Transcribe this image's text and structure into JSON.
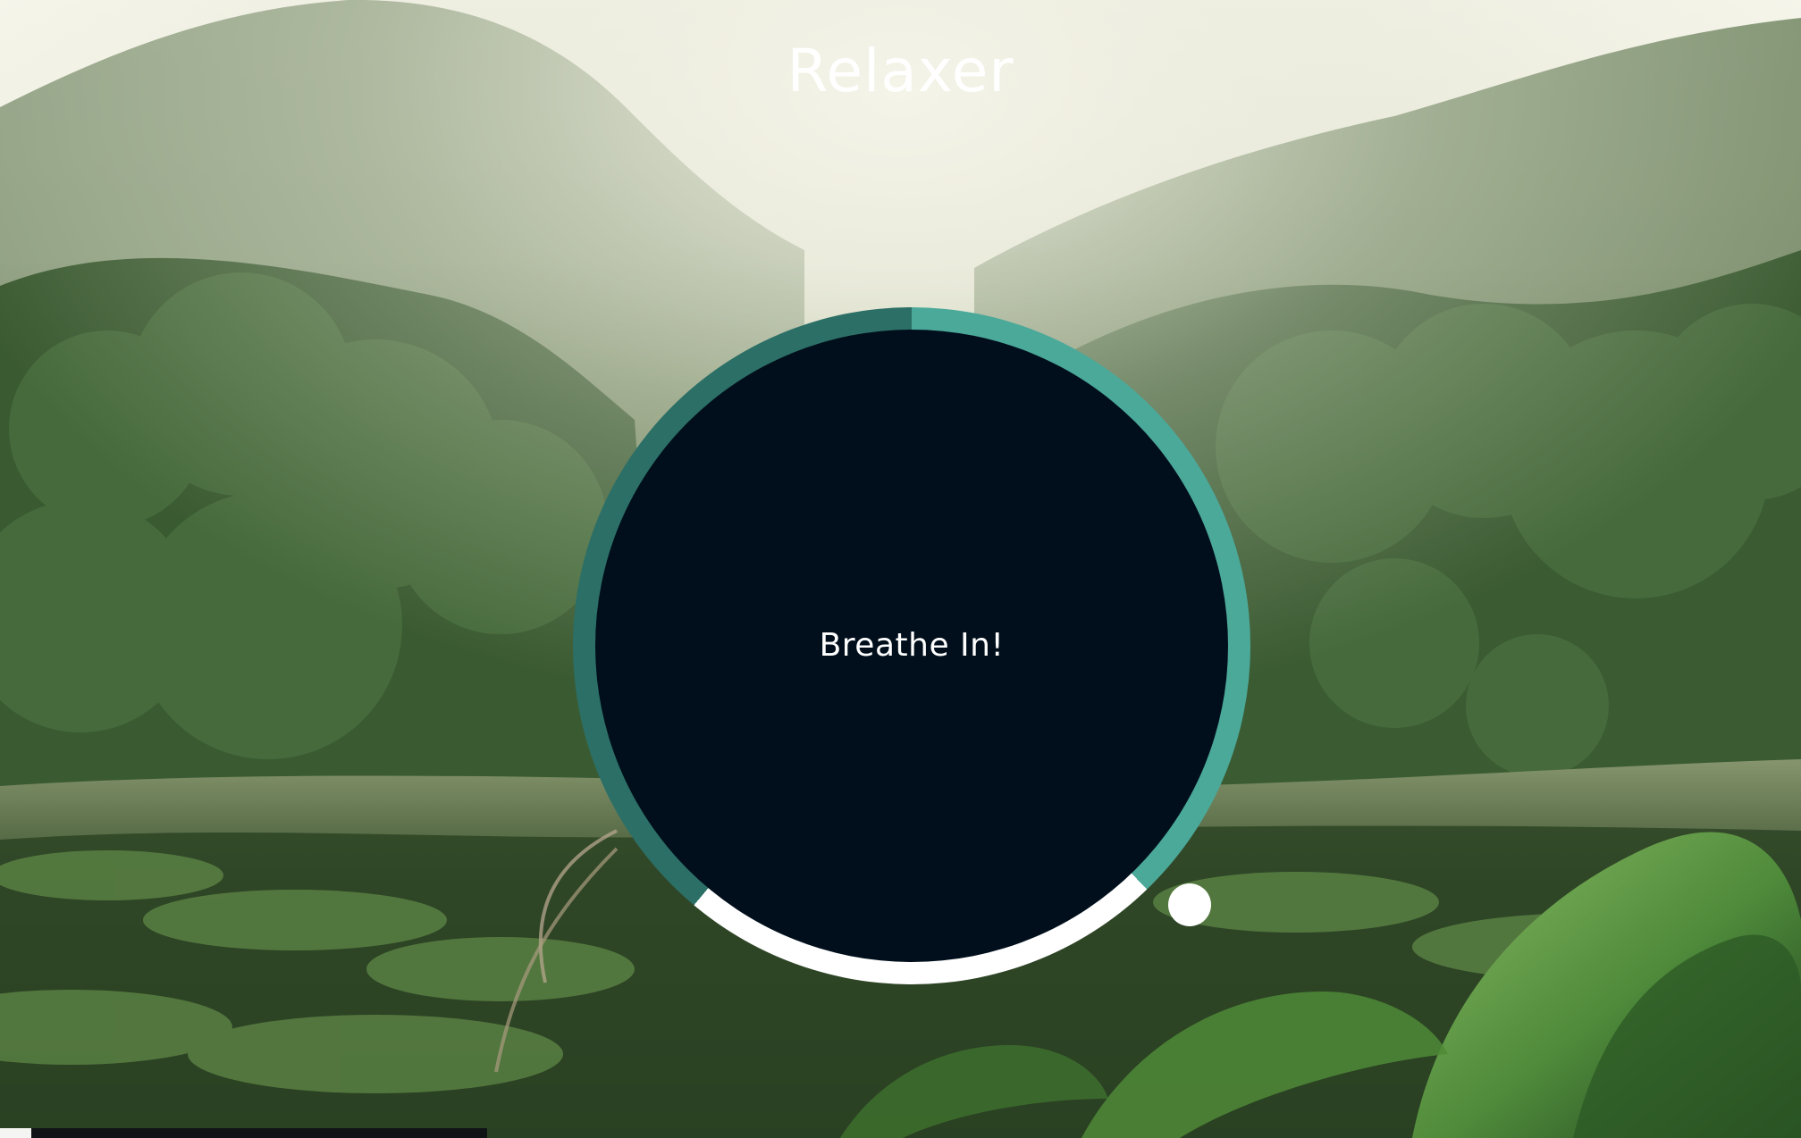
{
  "app": {
    "title": "Relaxer"
  },
  "breathing": {
    "instruction": "Breathe In!"
  },
  "colors": {
    "ring_light_teal": "#4ba99a",
    "ring_dark_teal": "#2c6f66",
    "ring_white": "#ffffff",
    "inner_circle": "#010f1c",
    "text": "#ffffff"
  },
  "icons": {
    "pointer": "breathing-pointer-dot"
  }
}
